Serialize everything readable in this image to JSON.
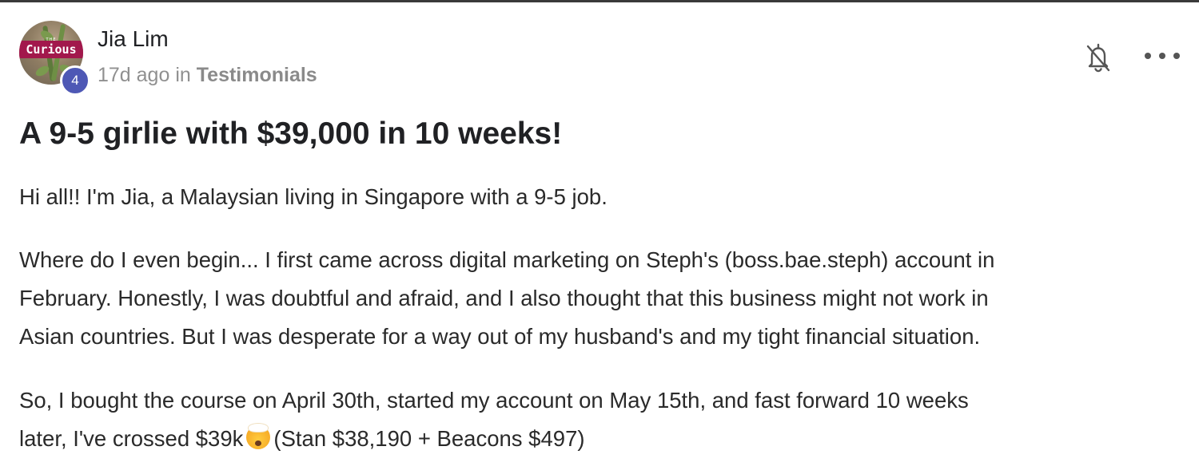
{
  "post": {
    "author": {
      "name": "Jia Lim",
      "avatar_text": "Curious",
      "avatar_small_text": "THE",
      "level": "4"
    },
    "meta": {
      "time": "17d ago",
      "in_word": "in",
      "category": "Testimonials"
    },
    "title": "A 9-5 girlie with $39,000 in 10 weeks!",
    "paragraphs": [
      {
        "lines": [
          "Hi all!! I'm Jia, a Malaysian living in Singapore with a 9-5 job."
        ]
      },
      {
        "lines": [
          "Where do I even begin... I first came across digital marketing on Steph's (boss.bae.steph) account in",
          "February. Honestly, I was doubtful and afraid, and I also thought that this business might not work in",
          "Asian countries. But I was desperate for a way out of my husband's and my tight financial situation."
        ]
      },
      {
        "line1": "So, I bought the course on April 30th, started my account on May 15th, and fast forward 10 weeks",
        "line2_before_emoji": "later, I've crossed $39k",
        "emoji_name": "exploding-head-emoji",
        "line2_after_emoji": "(Stan $38,190 + Beacons $497)"
      }
    ]
  },
  "icons": {
    "bell": "bell-off-icon",
    "more": "more-horizontal-icon"
  },
  "colors": {
    "level_badge": "#4e58b5",
    "avatar_banner": "#a2184c",
    "meta_text": "#909090"
  }
}
